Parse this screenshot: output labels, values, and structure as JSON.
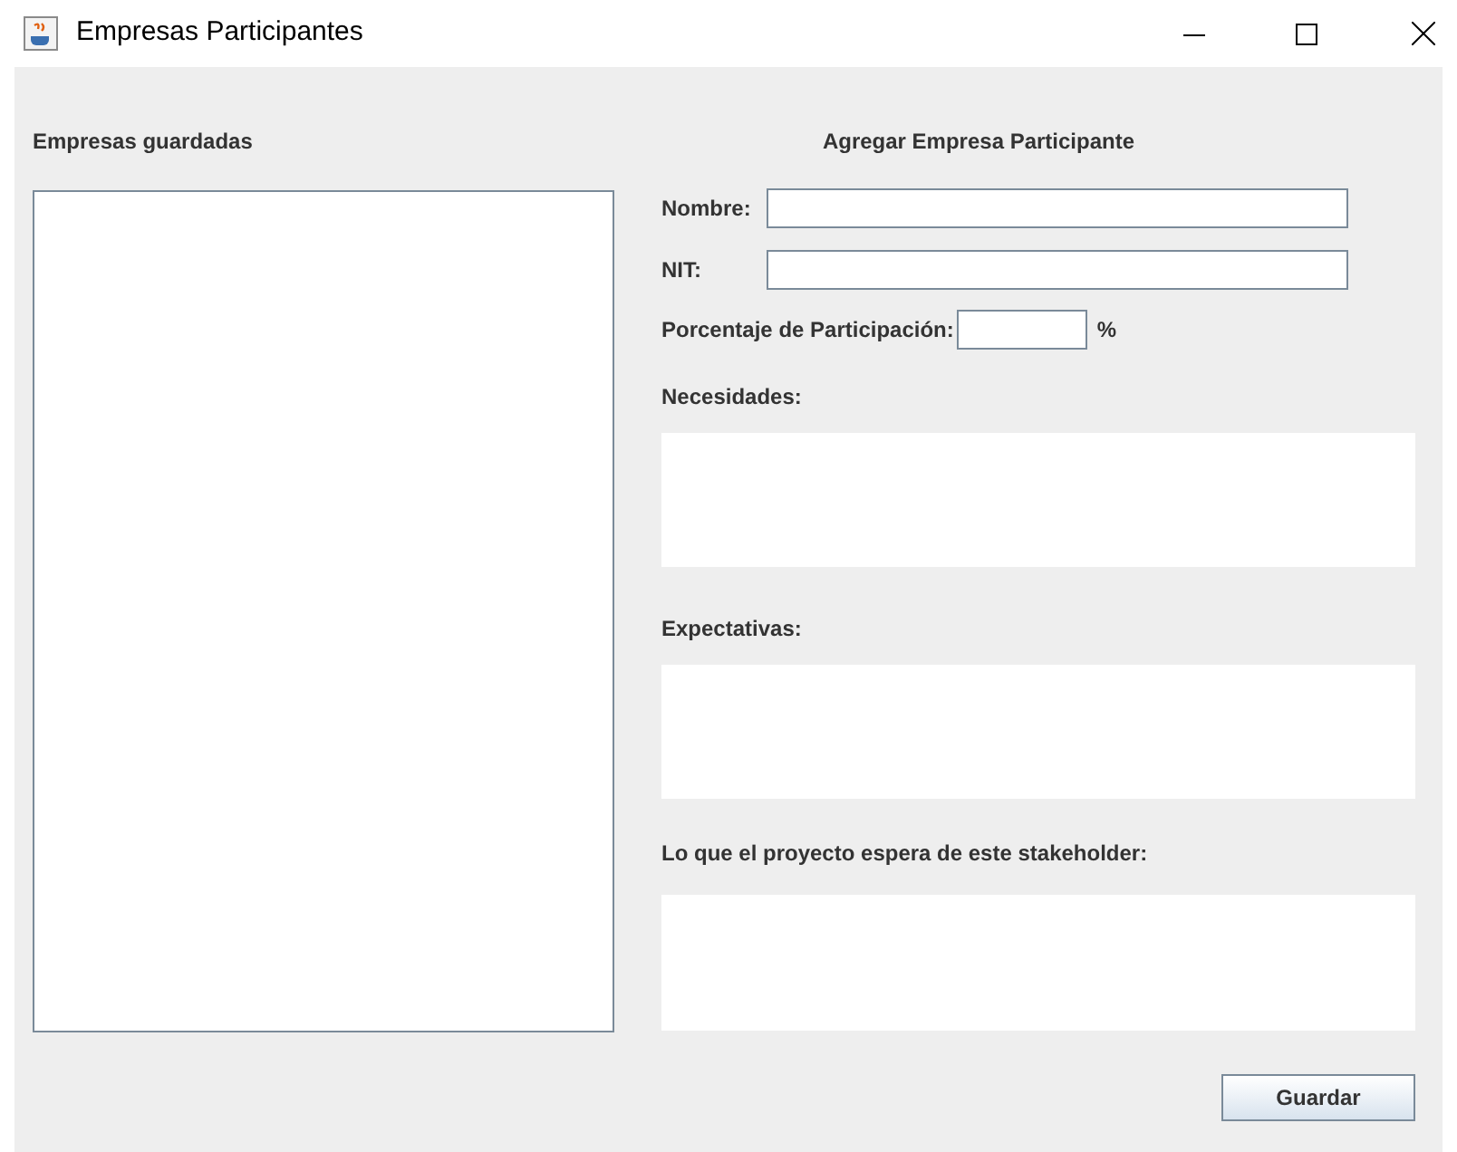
{
  "window": {
    "title": "Empresas Participantes"
  },
  "saved_list": {
    "label": "Empresas guardadas"
  },
  "form": {
    "heading": "Agregar Empresa Participante",
    "fields": [
      {
        "kind": "text",
        "label": "Nombre:"
      },
      {
        "kind": "text",
        "label": "NIT:"
      },
      {
        "kind": "percent",
        "label": "Porcentaje de Participación:",
        "suffix": "%"
      }
    ],
    "areas": [
      {
        "label": "Necesidades:"
      },
      {
        "label": "Expectativas:"
      },
      {
        "label": "Lo que el proyecto espera de este stakeholder:"
      }
    ]
  },
  "buttons": [
    {
      "label": "Guardar"
    }
  ]
}
